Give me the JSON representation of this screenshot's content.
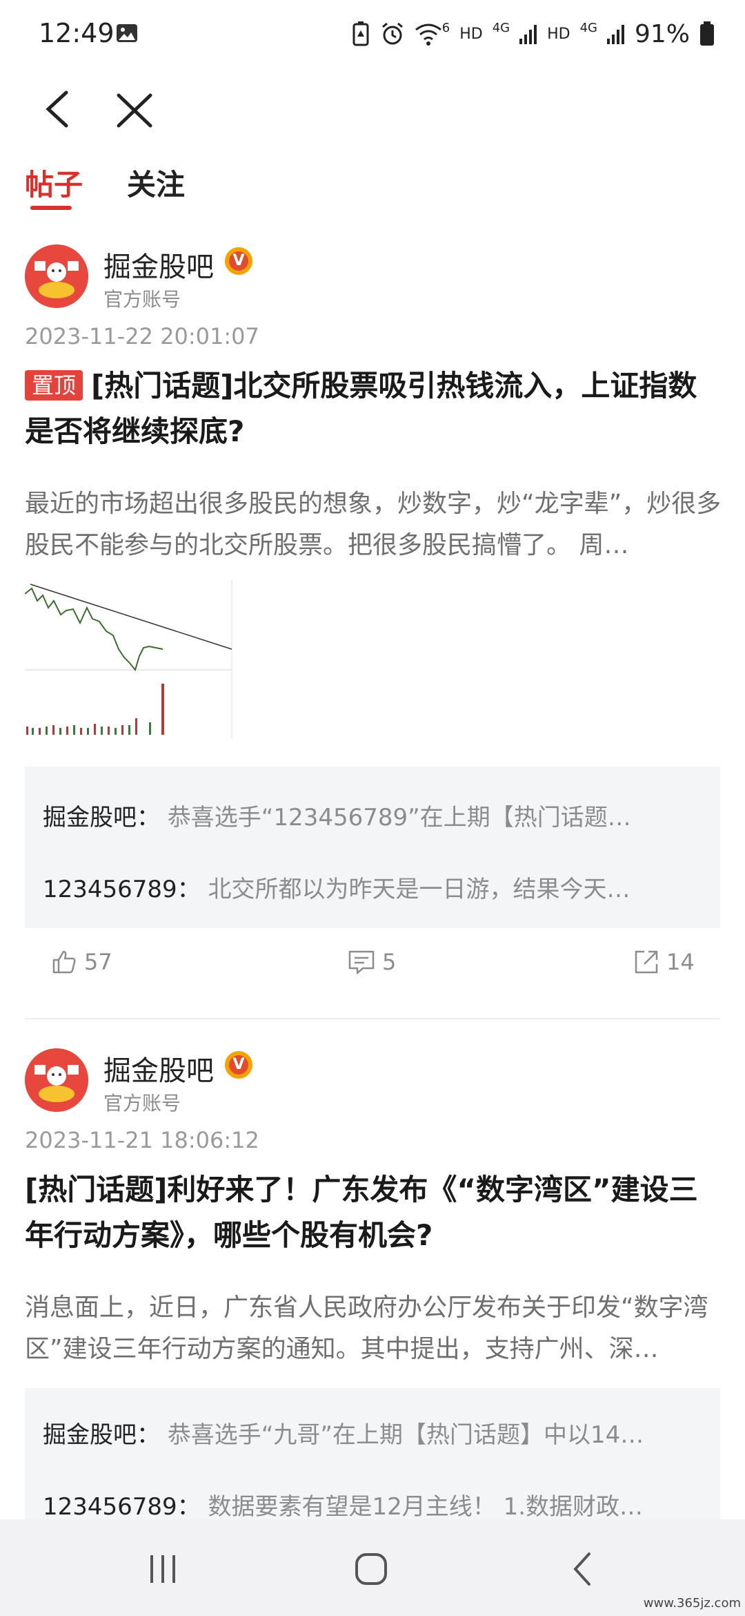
{
  "status_bar": {
    "time": "12:49",
    "hd1": "HD",
    "net1": "4G",
    "hd2": "HD",
    "net2": "4G",
    "wifi_sub": "6",
    "battery": "91%"
  },
  "tabs": [
    {
      "label": "帖子",
      "active": true
    },
    {
      "label": "关注",
      "active": false
    }
  ],
  "posts": [
    {
      "author": "掘金股吧",
      "account_type": "官方账号",
      "time": "2023-11-22 20:01:07",
      "pin_label": "置顶",
      "title": "[热门话题]北交所股票吸引热钱流入，上证指数是否将继续探底?",
      "body": "最近的市场超出很多股民的想象，炒数字，炒“龙字辈”，炒很多股民不能参与的北交所股票。把很多股民搞懵了。 周…",
      "comments": [
        {
          "name": "掘金股吧：",
          "text": "恭喜选手“123456789”在上期【热门话题…"
        },
        {
          "name": "123456789：",
          "text": "北交所都以为昨天是一日游，结果今天…"
        }
      ],
      "likes": "57",
      "comment_count": "5",
      "shares": "14"
    },
    {
      "author": "掘金股吧",
      "account_type": "官方账号",
      "time": "2023-11-21 18:06:12",
      "title": "[热门话题]利好来了！广东发布《“数字湾区”建设三年行动方案》，哪些个股有机会?",
      "body": "消息面上，近日，广东省人民政府办公厅发布关于印发“数字湾区”建设三年行动方案的通知。其中提出，支持广州、深…",
      "comments": [
        {
          "name": "掘金股吧：",
          "text": "恭喜选手“九哥”在上期【热门话题】中以14…"
        },
        {
          "name": "123456789：",
          "text": "数据要素有望是12月主线！ 1.数据财政…"
        }
      ]
    }
  ],
  "watermark": "www.365jz.com",
  "colors": {
    "accent": "#d9302c",
    "pin": "#e3433b",
    "comment_bg": "#f4f5f7"
  }
}
